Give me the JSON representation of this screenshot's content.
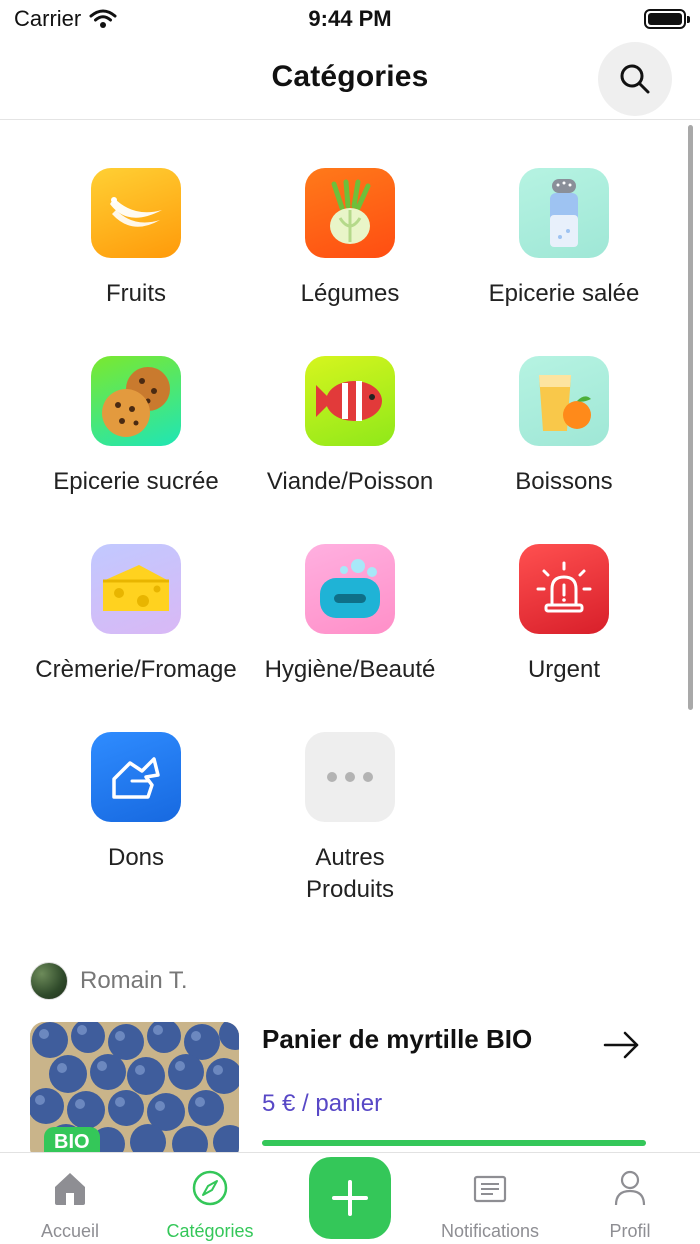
{
  "status_bar": {
    "carrier": "Carrier",
    "time": "9:44 PM"
  },
  "header": {
    "title": "Catégories"
  },
  "categories": [
    {
      "label": "Fruits",
      "icon": "banana-icon"
    },
    {
      "label": "Légumes",
      "icon": "fennel-icon"
    },
    {
      "label": "Epicerie salée",
      "icon": "salt-shaker-icon"
    },
    {
      "label": "Epicerie sucrée",
      "icon": "cookie-icon"
    },
    {
      "label": "Viande/Poisson",
      "icon": "fish-icon"
    },
    {
      "label": "Boissons",
      "icon": "juice-icon"
    },
    {
      "label": "Crèmerie/Fromage",
      "icon": "cheese-icon"
    },
    {
      "label": "Hygiène/Beauté",
      "icon": "soap-icon"
    },
    {
      "label": "Urgent",
      "icon": "alarm-icon"
    },
    {
      "label": "Dons",
      "icon": "donation-hand-icon"
    },
    {
      "label": "Autres Produits",
      "icon": "more-icon"
    }
  ],
  "post": {
    "author": "Romain T.",
    "title": "Panier de myrtille BIO",
    "price": "5 € / panier",
    "badge": "BIO",
    "progress": 1.0
  },
  "tab_bar": {
    "tabs": [
      {
        "label": "Accueil",
        "icon": "home-icon",
        "active": false
      },
      {
        "label": "Catégories",
        "icon": "compass-icon",
        "active": true
      },
      {
        "label": "",
        "icon": "plus-icon",
        "active": false
      },
      {
        "label": "Notifications",
        "icon": "newspaper-icon",
        "active": false
      },
      {
        "label": "Profil",
        "icon": "user-icon",
        "active": false
      }
    ]
  },
  "colors": {
    "accent": "#34c759",
    "price": "#5848c6"
  }
}
